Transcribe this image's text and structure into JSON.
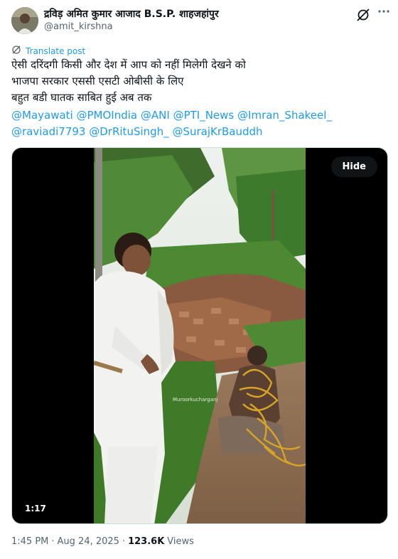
{
  "author": {
    "name": "द्रविड़ अमित कुमार आजाद B.S.P. शाहजहांपुर",
    "handle": "@amit_kirshna"
  },
  "icons": {
    "grok": "grok-icon",
    "more": "more-options-icon",
    "translate": "translate-icon"
  },
  "translate_label": "Translate post",
  "post_text": [
    "ऐसी दरिंदगी किसी और देश में आप को नहीं मिलेगी देखने को",
    "भाजपा सरकार एससी एसटी ओबीसी के लिए",
    "बहुत बडी घातक साबित हुई अब तक"
  ],
  "mentions_row1": [
    "@Mayawati",
    "@PMOIndia",
    "@ANI",
    "@PTI_News",
    "@Imran_Shakeel_"
  ],
  "mentions_row2": [
    "@raviadi7793",
    "@DrRituSingh_",
    "@SurajKrBauddh"
  ],
  "media": {
    "hide_label": "Hide",
    "duration": "1:17",
    "watermark": "Muroorkucharganj"
  },
  "meta": {
    "time": "1:45 PM",
    "separator": "·",
    "date": "Aug 24, 2025",
    "views_count": "123.6K",
    "views_label": "Views"
  },
  "colors": {
    "link": "#1d9bf0",
    "secondary": "#536471",
    "text": "#0f1419"
  }
}
